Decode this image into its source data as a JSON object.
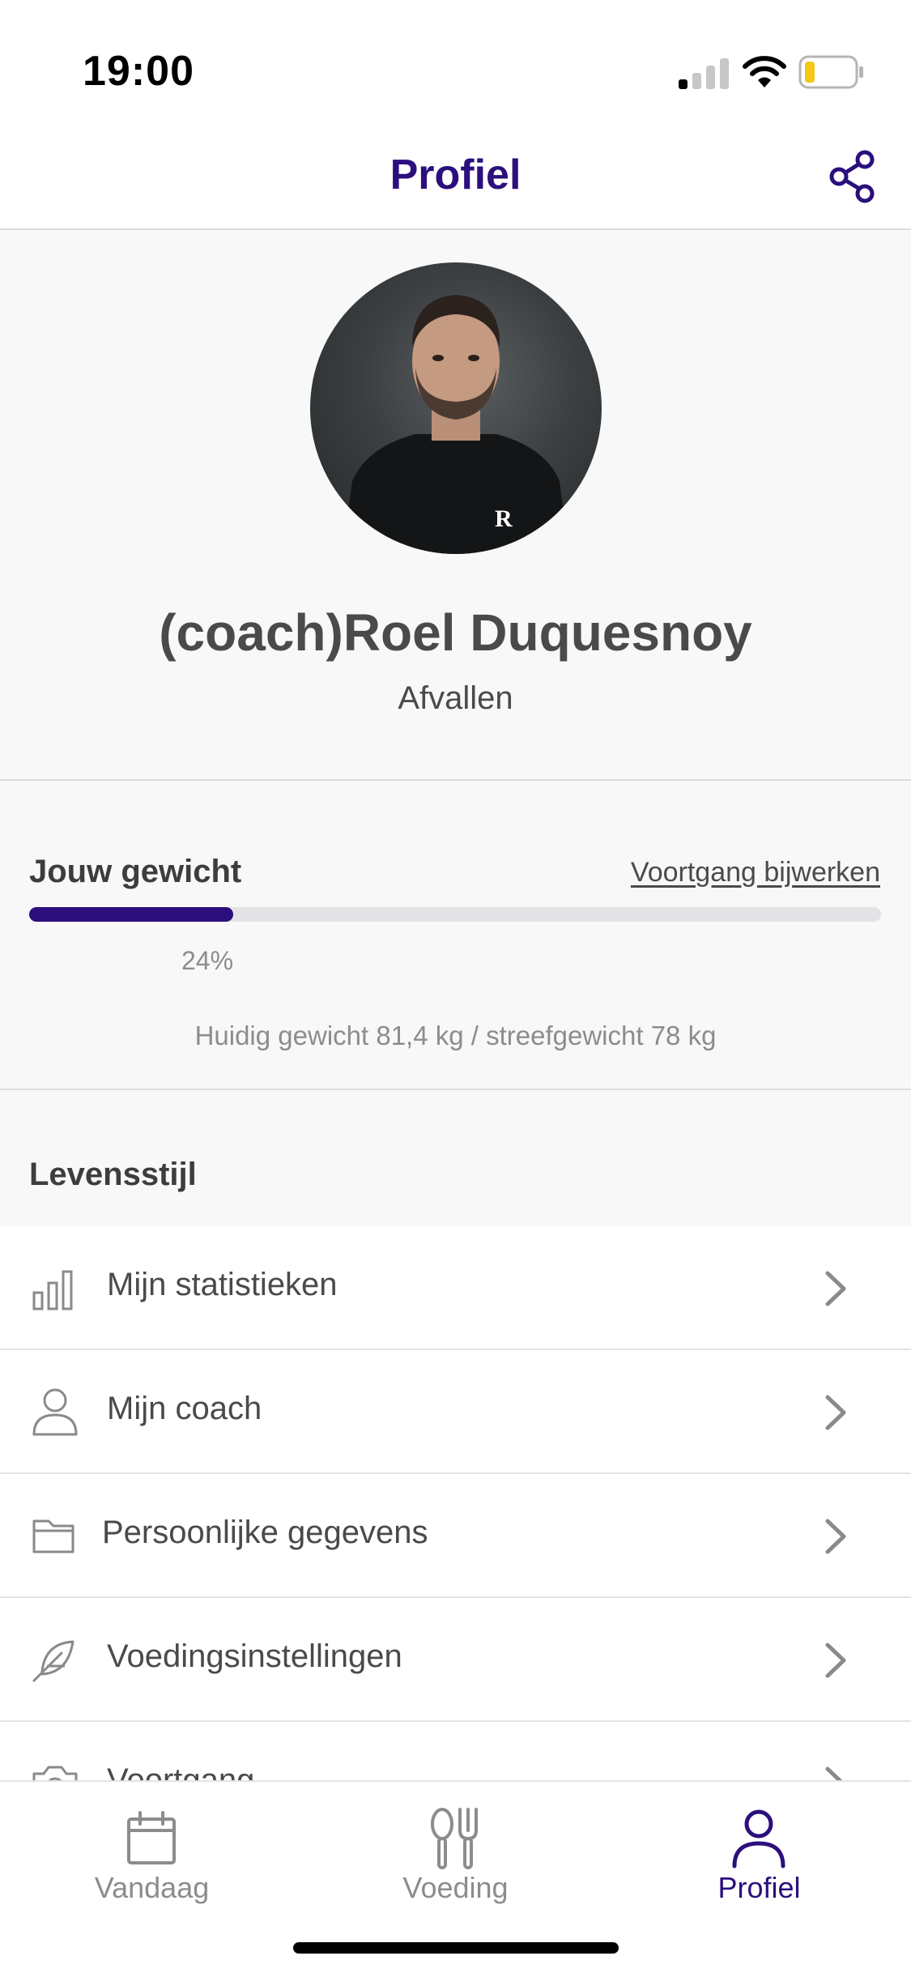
{
  "status_bar": {
    "time": "19:00"
  },
  "header": {
    "title": "Profiel"
  },
  "profile": {
    "name": "(coach)Roel Duquesnoy",
    "goal": "Afvallen",
    "shirt_logo": "R"
  },
  "weight": {
    "title": "Jouw gewicht",
    "update_link": "Voortgang bijwerken",
    "progress_fraction": 0.24,
    "progress_label": "24%",
    "detail": "Huidig gewicht 81,4 kg / streefgewicht 78 kg"
  },
  "lifestyle": {
    "title": "Levensstijl",
    "items": [
      {
        "label": "Mijn statistieken",
        "icon": "bar-chart-icon"
      },
      {
        "label": "Mijn coach",
        "icon": "person-icon"
      },
      {
        "label": "Persoonlijke gegevens",
        "icon": "folder-icon"
      },
      {
        "label": "Voedingsinstellingen",
        "icon": "feather-icon"
      },
      {
        "label": "Voortgang",
        "icon": "camera-icon"
      }
    ]
  },
  "tabs": [
    {
      "label": "Vandaag",
      "icon": "calendar-icon",
      "active": false
    },
    {
      "label": "Voeding",
      "icon": "cutlery-icon",
      "active": false
    },
    {
      "label": "Profiel",
      "icon": "person-icon",
      "active": true
    }
  ],
  "colors": {
    "accent": "#2b0f7c",
    "text": "#4a4a4a",
    "muted": "#8c8c8c",
    "battery": "#f2c716"
  }
}
